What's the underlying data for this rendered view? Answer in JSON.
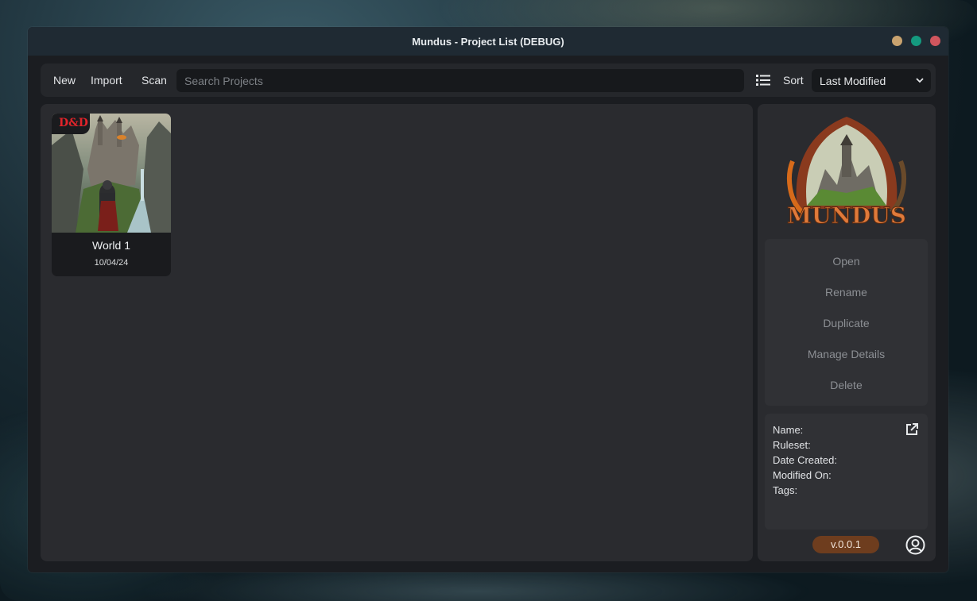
{
  "window": {
    "title": "Mundus - Project List (DEBUG)"
  },
  "toolbar": {
    "new_label": "New",
    "import_label": "Import",
    "scan_label": "Scan",
    "search_placeholder": "Search Projects",
    "sort_label": "Sort",
    "sort_value": "Last Modified"
  },
  "projects": [
    {
      "name": "World 1",
      "date": "10/04/24",
      "badge": "D&D"
    }
  ],
  "logo": {
    "text": "MUNDUS"
  },
  "actions": {
    "open": "Open",
    "rename": "Rename",
    "duplicate": "Duplicate",
    "manage_details": "Manage Details",
    "delete": "Delete"
  },
  "details": {
    "name_label": "Name:",
    "ruleset_label": "Ruleset:",
    "date_created_label": "Date Created:",
    "modified_on_label": "Modified On:",
    "tags_label": "Tags:"
  },
  "version": "v.0.0.1",
  "colors": {
    "accent_version": "#6e3d1e",
    "min": "#c9a36f",
    "max": "#149a7f",
    "close": "#d1565e"
  }
}
